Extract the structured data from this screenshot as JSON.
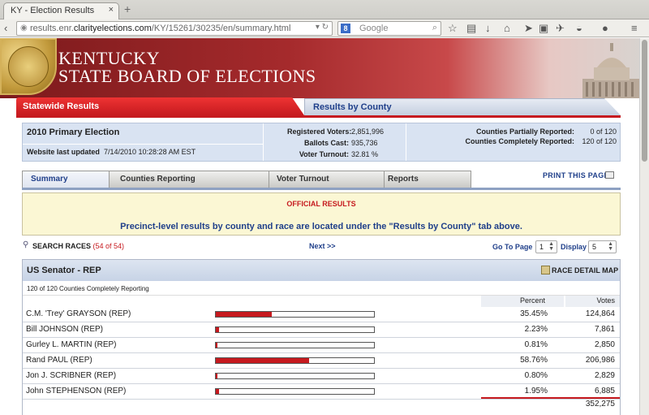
{
  "browser": {
    "tab_title": "KY - Election Results",
    "tab_close": "×",
    "new_tab": "+",
    "url_prefix": "results.enr.",
    "url_domain": "clarityelections.com",
    "url_path": "/KY/15261/30235/en/summary.html",
    "search_placeholder": "Google",
    "search_engine_letter": "8"
  },
  "banner": {
    "line1": "KENTUCKY",
    "line2": "STATE BOARD OF ELECTIONS"
  },
  "main_tabs": {
    "statewide": "Statewide Results",
    "county": "Results by County"
  },
  "election": {
    "name": "2010 Primary Election",
    "updated_label": "Website last updated",
    "updated_value": "7/14/2010 10:28:28 AM EST",
    "registered_label": "Registered Voters:",
    "registered_value": "2,851,996",
    "ballots_label": "Ballots Cast:",
    "ballots_value": "935,736",
    "turnout_label": "Voter Turnout:",
    "turnout_value": "32.81 %",
    "partial_label": "Counties Partially Reported:",
    "partial_value": "0 of 120",
    "complete_label": "Counties Completely Reported:",
    "complete_value": "120 of 120"
  },
  "sub_tabs": {
    "summary": "Summary",
    "counties": "Counties Reporting",
    "turnout": "Voter Turnout",
    "reports": "Reports",
    "print": "PRINT THIS PAGE"
  },
  "notice": {
    "title": "OFFICIAL RESULTS",
    "text": "Precinct-level results by county and race are located under the \"Results by County\" tab above."
  },
  "controls": {
    "search_label": "SEARCH RACES",
    "search_count": "(54 of 54)",
    "next": "Next >>",
    "goto_label": "Go To Page",
    "goto_value": "1",
    "display_label": "Display",
    "display_value": "5"
  },
  "race": {
    "title": "US Senator - REP",
    "map_label": "RACE DETAIL MAP",
    "reporting": "120 of 120 Counties Completely Reporting",
    "col_percent": "Percent",
    "col_votes": "Votes",
    "candidates": [
      {
        "name": "C.M. 'Trey' GRAYSON (REP)",
        "pct": "35.45%",
        "share": 35.45,
        "votes": "124,864"
      },
      {
        "name": "Bill JOHNSON (REP)",
        "pct": "2.23%",
        "share": 2.23,
        "votes": "7,861"
      },
      {
        "name": "Gurley L. MARTIN (REP)",
        "pct": "0.81%",
        "share": 0.81,
        "votes": "2,850"
      },
      {
        "name": "Rand PAUL (REP)",
        "pct": "58.76%",
        "share": 58.76,
        "votes": "206,986"
      },
      {
        "name": "Jon J. SCRIBNER (REP)",
        "pct": "0.80%",
        "share": 0.8,
        "votes": "2,829"
      },
      {
        "name": "John STEPHENSON (REP)",
        "pct": "1.95%",
        "share": 1.95,
        "votes": "6,885"
      }
    ],
    "total": "352,275"
  },
  "colors": {
    "accent_red": "#c61a1f",
    "link_blue": "#1f3f8a",
    "info_bg": "#d9e3f2",
    "notice_bg": "#fbf7d4"
  }
}
